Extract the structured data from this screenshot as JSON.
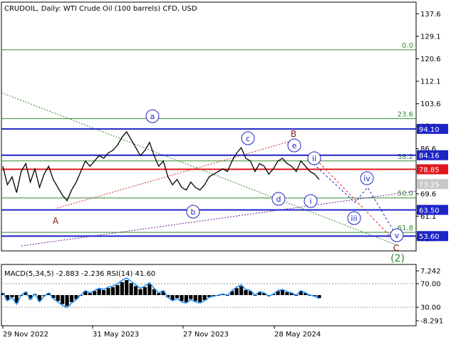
{
  "chart_data": {
    "type": "line",
    "title": "CRUDOIL, Daily:  WTI Crude Oil (100 barrels) CFD, USD",
    "x_labels": [
      "29 Nov 2022",
      "31 May 2023",
      "27 Nov 2023",
      "28 May 2024"
    ],
    "y_ticks": [
      137.6,
      129.1,
      120.6,
      112.1,
      103.6,
      95.1,
      86.6,
      78.1,
      69.6,
      61.1,
      52.6
    ],
    "ylim": [
      48,
      142
    ],
    "price": [
      80,
      73,
      76,
      70,
      78,
      81,
      74,
      79,
      72,
      77,
      80,
      75,
      72,
      69,
      67,
      71,
      74,
      78,
      82,
      80,
      82,
      84,
      83,
      85,
      86,
      88,
      91,
      93,
      90,
      87,
      84,
      86,
      89,
      84,
      80,
      82,
      76,
      73,
      75,
      72,
      71,
      74,
      72,
      71,
      73,
      76,
      77,
      78,
      79,
      78,
      82,
      85,
      87,
      83,
      82,
      78,
      81,
      80,
      77,
      79,
      82,
      83,
      81,
      80,
      78,
      82,
      80,
      78,
      77,
      75
    ],
    "current_price": "73.25",
    "levels": [
      {
        "label": "94.10",
        "value": 94.1,
        "color": "#1d24c7"
      },
      {
        "label": "84.16",
        "value": 84.16,
        "color": "#1d24c7"
      },
      {
        "label": "78.85",
        "value": 78.85,
        "color": "#e0161c"
      },
      {
        "label": "63.50",
        "value": 63.5,
        "color": "#1d24c7"
      },
      {
        "label": "53.60",
        "value": 53.6,
        "color": "#1d24c7"
      }
    ],
    "fib_levels": [
      {
        "label": "0.0",
        "value": 124.0
      },
      {
        "label": "23.6",
        "value": 98.0
      },
      {
        "label": "38.2",
        "value": 82.0
      },
      {
        "label": "50.0",
        "value": 68.0
      },
      {
        "label": "61.8",
        "value": 55.0
      }
    ],
    "wave_labels": [
      {
        "text": "a",
        "style": "circle"
      },
      {
        "text": "b",
        "style": "circle"
      },
      {
        "text": "c",
        "style": "circle"
      },
      {
        "text": "d",
        "style": "circle"
      },
      {
        "text": "e",
        "style": "circle"
      },
      {
        "text": "i",
        "style": "circle"
      },
      {
        "text": "ii",
        "style": "circle"
      },
      {
        "text": "iii",
        "style": "circle"
      },
      {
        "text": "iv",
        "style": "circle"
      },
      {
        "text": "v",
        "style": "circle"
      },
      {
        "text": "A",
        "style": "plain"
      },
      {
        "text": "B",
        "style": "plain"
      },
      {
        "text": "C",
        "style": "plain"
      },
      {
        "text": "(2)",
        "style": "plain"
      }
    ],
    "indicator": {
      "label": "MACD(5,34,5) -2.883 -2.236 RSI(14) 41.60",
      "y_ticks": [
        "7.242",
        "70.00",
        "30.00",
        "-8.291"
      ]
    },
    "colors": {
      "blue_level": "#1d24c7",
      "red_level": "#e0161c",
      "fib": "#2e8b2e",
      "price": "#000000",
      "wave_label": "#1d24c7",
      "wave_abc": "#8b1a1a",
      "wave_2": "#2e8b2e",
      "rsi": "#1e90ff"
    }
  }
}
